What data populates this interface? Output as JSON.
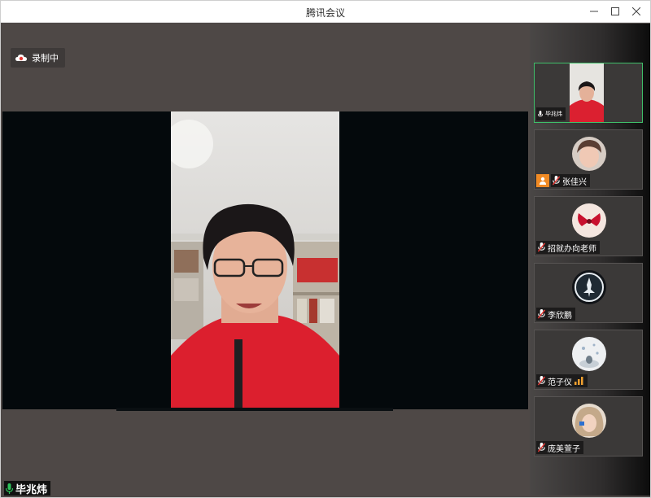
{
  "window": {
    "title": "腾讯会议"
  },
  "recording": {
    "label": "录制中"
  },
  "main": {
    "speaker_name": "毕兆炜"
  },
  "participants": [
    {
      "name": "毕兆炜"
    },
    {
      "name": "张佳兴"
    },
    {
      "name": "招就办向老师"
    },
    {
      "name": "李欣鹏"
    },
    {
      "name": "范子仪"
    },
    {
      "name": "庞美萱子"
    }
  ],
  "colors": {
    "active_border": "#3fbf6a",
    "recording_icon": "#e53935",
    "host_badge": "#f08a24",
    "signal": "#f0a030"
  }
}
